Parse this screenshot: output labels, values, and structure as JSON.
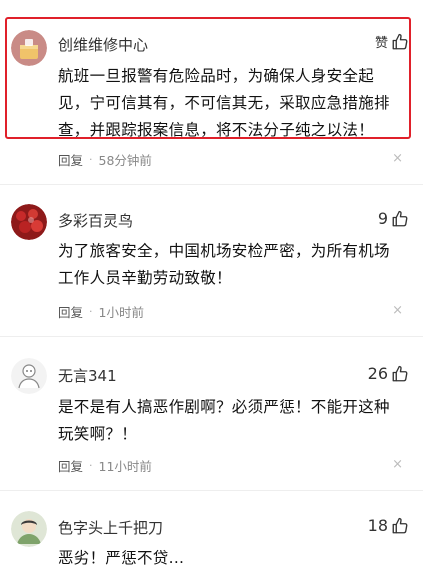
{
  "comments": [
    {
      "author": "创维维修中心",
      "likes_label": "赞",
      "body_lines": [
        "航班一旦报警有危险品时，为确保人身安全起",
        "见，宁可信其有，不可信其无，采取应急措施排",
        "查，并跟踪报案信息，将不法分子纯之以法！"
      ],
      "reply_label": "回复",
      "separator": "·",
      "time": "58分钟前",
      "close": "×",
      "highlighted": true
    },
    {
      "author": "多彩百灵鸟",
      "likes_label": "9",
      "body_lines": [
        "为了旅客安全，中国机场安检严密，为所有机场",
        "工作人员辛勤劳动致敬！"
      ],
      "reply_label": "回复",
      "separator": "·",
      "time": "1小时前",
      "close": "×"
    },
    {
      "author": "无言341",
      "likes_label": "26",
      "body_lines": [
        "是不是有人搞恶作剧啊？必须严惩！不能开这种",
        "玩笑啊？！"
      ],
      "reply_label": "回复",
      "separator": "·",
      "time": "11小时前",
      "close": "×"
    },
    {
      "author": "色字头上千把刀",
      "likes_label": "18",
      "body_lines": [
        "恶劣！严惩不贷..."
      ]
    }
  ],
  "colors": {
    "highlight_border": "#e0202a",
    "meta_text": "#888888",
    "divider": "#eeeeee"
  },
  "icons": {
    "like": "thumbs-up-icon",
    "close": "close-icon"
  }
}
